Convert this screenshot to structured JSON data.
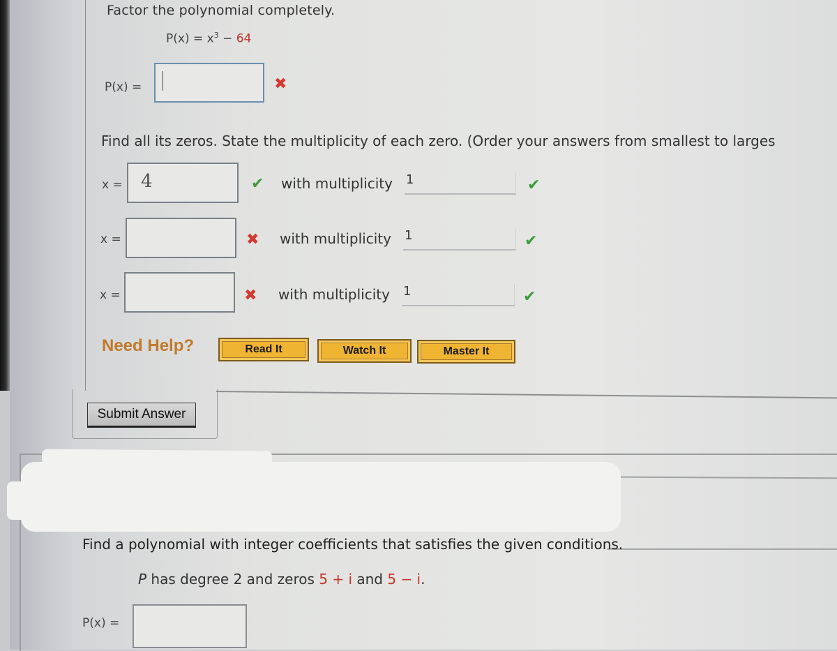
{
  "question1": {
    "title": "Factor the polynomial completely.",
    "equation": {
      "lhs": "P(x) = x",
      "exponent": "3",
      "op": " − ",
      "constant": "64"
    },
    "factor_answer": {
      "label": "P(x) =",
      "value": "",
      "status_icon": "x-mark-icon"
    },
    "zeros_instruction": "Find all its zeros. State the multiplicity of each zero. (Order your answers from smallest to larges",
    "zero_rows": [
      {
        "label": "x =",
        "value": "4",
        "status_icon": "check-icon",
        "mult_label": "with multiplicity",
        "mult_value": "1",
        "mult_status_icon": "check-icon"
      },
      {
        "label": "x =",
        "value": "",
        "status_icon": "x-mark-icon",
        "mult_label": "with multiplicity",
        "mult_value": "1",
        "mult_status_icon": "check-icon"
      },
      {
        "label": "x =",
        "value": "",
        "status_icon": "x-mark-icon",
        "mult_label": "with multiplicity",
        "mult_value": "1",
        "mult_status_icon": "check-icon"
      }
    ],
    "need_help": {
      "label": "Need Help?",
      "buttons": [
        "Read It",
        "Watch It",
        "Master It"
      ]
    },
    "submit_label": "Submit Answer"
  },
  "question2": {
    "title": "Find a polynomial with integer coefficients that satisfies the given conditions.",
    "condition": {
      "subject": "P",
      "text": " has degree 2 and zeros ",
      "zero1": "5 + i",
      "and": " and ",
      "zero2": "5 − i",
      "end": "."
    },
    "answer": {
      "label": "P(x) =",
      "value": ""
    }
  },
  "icons": {
    "x_mark": "✖",
    "check": "✔"
  },
  "colors": {
    "error_red": "#d33a31",
    "success_green": "#3f9a3a",
    "help_orange": "#c07a2a",
    "help_button_fill": "#f0b433",
    "math_red": "#c8332b"
  }
}
